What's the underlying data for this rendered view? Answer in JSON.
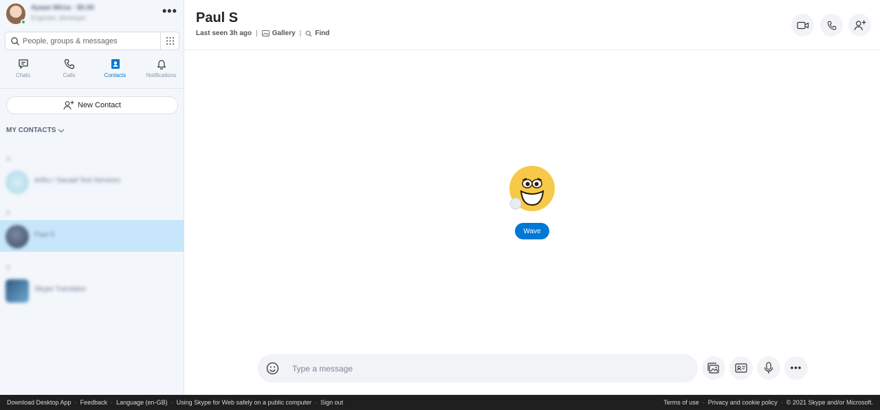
{
  "profile": {
    "name": "Ayaan Mirza · $0.00",
    "subtitle": "Engineer, developer"
  },
  "search": {
    "placeholder": "People, groups & messages"
  },
  "nav": {
    "chats": "Chats",
    "calls": "Calls",
    "contacts": "Contacts",
    "notifications": "Notifications"
  },
  "new_contact_label": "New Contact",
  "section": {
    "title": "MY CONTACTS"
  },
  "contacts": [
    {
      "letter": "A",
      "name": "Arthu / Sacaal Test Services"
    },
    {
      "letter": "P",
      "name": "Paul S"
    },
    {
      "letter": "S",
      "name": "Skype Translator"
    }
  ],
  "chat": {
    "title": "Paul S",
    "last_seen": "Last seen 3h ago",
    "gallery": "Gallery",
    "find": "Find",
    "wave_label": "Wave",
    "message_placeholder": "Type a message"
  },
  "footer": {
    "left": [
      "Download Desktop App",
      "Feedback",
      "Language (en-GB)",
      "Using Skype for Web safely on a public computer",
      "Sign out"
    ],
    "right": [
      "Terms of use",
      "Privacy and cookie policy",
      "© 2021 Skype and/or Microsoft."
    ]
  },
  "colors": {
    "accent": "#0078d4",
    "selected_row": "#c7e6fb",
    "sidebar_bg": "#f3f6fb"
  }
}
